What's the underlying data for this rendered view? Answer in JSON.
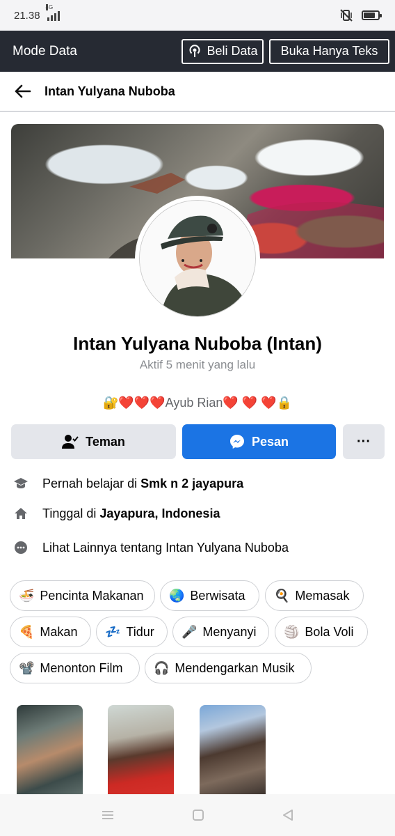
{
  "status_bar": {
    "time": "21.38",
    "network": "4G",
    "battery_level": 0.8
  },
  "data_mode": {
    "label": "Mode Data",
    "buy_data": "Beli Data",
    "text_only": "Buka Hanya Teks"
  },
  "header": {
    "title": "Intan Yulyana Nuboba"
  },
  "profile": {
    "name": "Intan Yulyana Nuboba (Intan)",
    "active": "Aktif 5 menit yang lalu",
    "bio": "🔐❤️❤️❤️Ayub Rian❤️ ❤️ ❤️🔒"
  },
  "actions": {
    "friend": "Teman",
    "message": "Pesan",
    "more": "···"
  },
  "info": {
    "education_prefix": "Pernah belajar di ",
    "education_value": "Smk n 2 jayapura",
    "home_prefix": "Tinggal di ",
    "home_value": "Jayapura, Indonesia",
    "see_more": "Lihat Lainnya tentang Intan Yulyana Nuboba"
  },
  "interests": [
    {
      "emoji": "🍜",
      "label": "Pencinta Makanan"
    },
    {
      "emoji": "🌏",
      "label": "Berwisata"
    },
    {
      "emoji": "🍳",
      "label": "Memasak"
    },
    {
      "emoji": "🍕",
      "label": "Makan"
    },
    {
      "emoji": "💤",
      "label": "Tidur"
    },
    {
      "emoji": "🎤",
      "label": "Menyanyi"
    },
    {
      "emoji": "🏐",
      "label": "Bola Voli"
    },
    {
      "emoji": "📽️",
      "label": "Menonton Film"
    },
    {
      "emoji": "🎧",
      "label": "Mendengarkan Musik"
    }
  ],
  "colors": {
    "accent": "#1b74e4",
    "data_bar": "#262a33",
    "button_gray": "#e4e6eb"
  }
}
